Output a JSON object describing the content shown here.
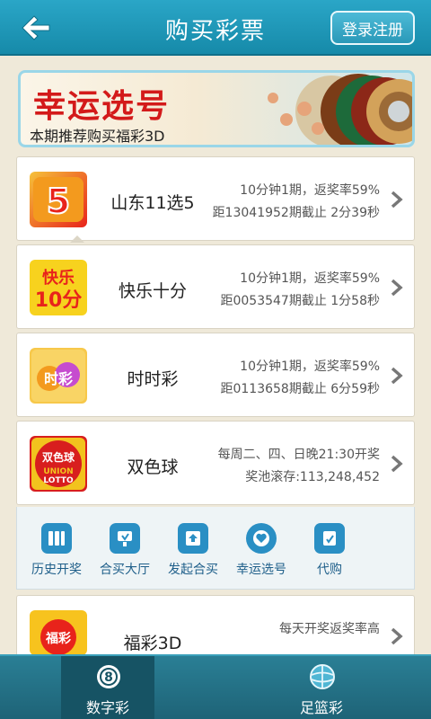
{
  "header": {
    "title": "购买彩票",
    "login_label": "登录注册"
  },
  "banner": {
    "title": "幸运选号",
    "subtitle": "本期推荐购买福彩3D"
  },
  "lotteries": [
    {
      "logo_text": "5",
      "name": "山东11选5",
      "info1": "10分钟1期，返奖率59%",
      "info2": "距13041952期截止 2分39秒",
      "colors": [
        "#f39a1e",
        "#e8231b"
      ]
    },
    {
      "logo_text": "快乐10分",
      "name": "快乐十分",
      "info1": "10分钟1期，返奖率59%",
      "info2": "距0053547期截止 1分58秒",
      "colors": [
        "#f7d21e",
        "#e8231b"
      ]
    },
    {
      "logo_text": "时时彩",
      "name": "时时彩",
      "info1": "10分钟1期，返奖率59%",
      "info2": "距0113658期截止 6分59秒",
      "colors": [
        "#f7a81e",
        "#9b3db8"
      ]
    },
    {
      "logo_text": "双色球 UNION LOTTO",
      "name": "双色球",
      "info1": "每周二、四、日晚21:30开奖",
      "info2": "奖池滚存:113,248,452",
      "colors": [
        "#d81e1e",
        "#f2c31e"
      ]
    },
    {
      "logo_text": "福彩",
      "name": "福彩3D",
      "info1": "每天开奖返奖率高",
      "info2": "",
      "colors": [
        "#f7c31e",
        "#e8231b"
      ]
    }
  ],
  "tools": [
    {
      "label": "历史开奖",
      "icon": "history-icon"
    },
    {
      "label": "合买大厅",
      "icon": "trophy-icon"
    },
    {
      "label": "发起合买",
      "icon": "upload-icon"
    },
    {
      "label": "幸运选号",
      "icon": "heart-icon"
    },
    {
      "label": "代购",
      "icon": "cart-icon"
    }
  ],
  "bottom_nav": {
    "tabs": [
      {
        "label": "数字彩",
        "icon": "lottery-ball-icon",
        "active": true
      },
      {
        "label": "足篮彩",
        "icon": "ball-icon",
        "active": false
      }
    ]
  },
  "accent_color": "#1f93b5"
}
